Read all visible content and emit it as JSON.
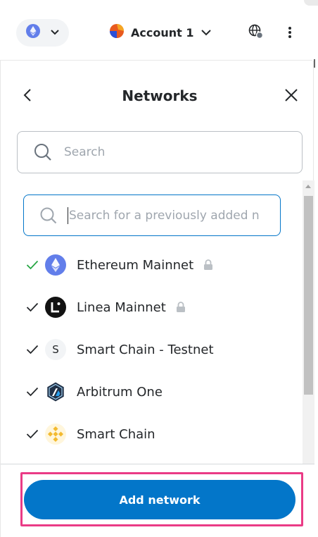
{
  "header": {
    "network_icon": "ethereum-icon",
    "account_name": "Account 1",
    "globe_icon": "globe-icon",
    "menu_icon": "kebab-menu-icon"
  },
  "modal": {
    "title": "Networks",
    "search_placeholder": "Search",
    "previous_search_placeholder": "Search for a previously added n"
  },
  "networks": [
    {
      "name": "Ethereum Mainnet",
      "icon": "ethereum-icon",
      "checked": true,
      "check_color": "#28a745",
      "locked": true
    },
    {
      "name": "Linea Mainnet",
      "icon": "linea-icon",
      "checked": true,
      "check_color": "#24272a",
      "locked": true
    },
    {
      "name": "Smart Chain - Testnet",
      "icon": "letter-s-avatar",
      "avatar_letter": "S",
      "checked": true,
      "check_color": "#24272a",
      "locked": false
    },
    {
      "name": "Arbitrum One",
      "icon": "arbitrum-icon",
      "checked": true,
      "check_color": "#24272a",
      "locked": false
    },
    {
      "name": "Smart Chain",
      "icon": "bnb-icon",
      "checked": true,
      "check_color": "#24272a",
      "locked": false
    }
  ],
  "footer": {
    "add_network_label": "Add network"
  },
  "colors": {
    "primary": "#0376c9",
    "highlight": "#ea3b86",
    "text": "#24272a"
  }
}
